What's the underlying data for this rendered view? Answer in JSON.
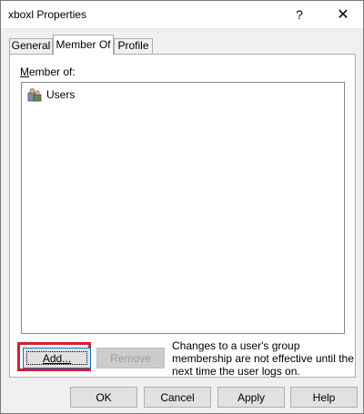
{
  "window": {
    "title": "xboxl Properties",
    "help_glyph": "?",
    "close_glyph": "✕"
  },
  "tabs": [
    {
      "label": "General"
    },
    {
      "label": "Member Of"
    },
    {
      "label": "Profile"
    }
  ],
  "member_of": {
    "label_prefix": "M",
    "label_rest": "ember of:",
    "items": [
      {
        "name": "Users",
        "icon": "users-group-icon"
      }
    ]
  },
  "actions": {
    "add_label": "Add...",
    "remove_label": "Remove",
    "note": "Changes to a user's group membership are not effective until the next time the user logs on."
  },
  "footer": {
    "ok": "OK",
    "cancel": "Cancel",
    "apply": "Apply",
    "help": "Help"
  },
  "colors": {
    "highlight": "#d6202a",
    "focus_border": "#0078d7"
  }
}
